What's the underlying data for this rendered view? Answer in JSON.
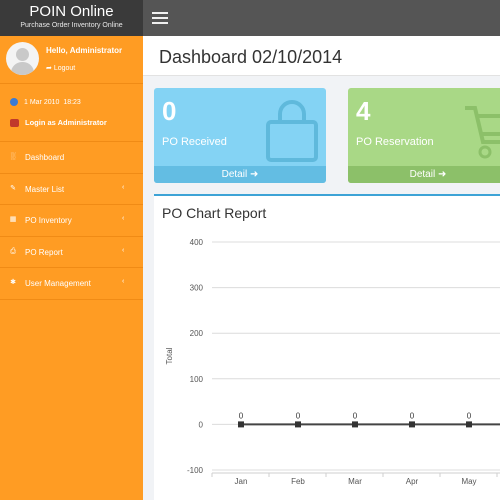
{
  "brand": {
    "title": "POIN Online",
    "subtitle": "Purchase Order Inventory Online"
  },
  "user": {
    "greeting": "Hello, Administrator",
    "logout_label": "Logout"
  },
  "info": {
    "date": "1 Mar 2010",
    "time": "18:23",
    "login_text": "Login as Administrator"
  },
  "nav": [
    {
      "label": "Dashboard",
      "icon": "bar-chart-icon",
      "has_submenu": false
    },
    {
      "label": "Master List",
      "icon": "edit-icon",
      "has_submenu": true
    },
    {
      "label": "PO Inventory",
      "icon": "cart-icon",
      "has_submenu": true
    },
    {
      "label": "PO Report",
      "icon": "printer-icon",
      "has_submenu": true
    },
    {
      "label": "User Management",
      "icon": "asterisk-icon",
      "has_submenu": true
    }
  ],
  "page": {
    "title": "Dashboard 02/10/2014"
  },
  "cards": [
    {
      "value": "0",
      "label": "PO Received",
      "detail": "Detail",
      "icon": "shopping-bag-icon",
      "color": "#84d3f4"
    },
    {
      "value": "4",
      "label": "PO Reservation",
      "detail": "Detail",
      "icon": "shopping-cart-icon",
      "color": "#a9d886"
    }
  ],
  "chart_panel": {
    "title": "PO Chart Report"
  },
  "chart_data": {
    "type": "line",
    "title": "",
    "xlabel": "",
    "ylabel": "Total",
    "categories": [
      "Jan",
      "Feb",
      "Mar",
      "Apr",
      "May"
    ],
    "series": [
      {
        "values": [
          0,
          0,
          0,
          0,
          0
        ]
      }
    ],
    "data_labels": [
      "0",
      "0",
      "0",
      "0",
      "0"
    ],
    "ylim": [
      -100,
      400
    ],
    "yticks": [
      400,
      300,
      200,
      100,
      0,
      -100
    ],
    "grid": true
  }
}
